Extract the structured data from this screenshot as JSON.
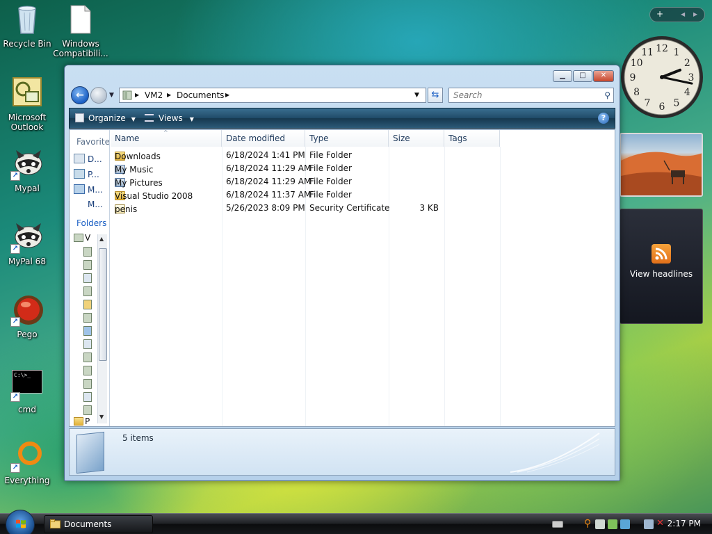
{
  "desktop": {
    "icons": [
      {
        "label": "Recycle Bin"
      },
      {
        "label": "Windows Compatibili..."
      },
      {
        "label": "Microsoft Outlook"
      },
      {
        "label": "Mypal"
      },
      {
        "label": "MyPal 68"
      },
      {
        "label": "Pego"
      },
      {
        "label": "cmd"
      },
      {
        "label": "Everything"
      }
    ],
    "cmd_prompt_text": "C:\\>_"
  },
  "gadgets": {
    "bar_plus": "+",
    "bar_prev": "◀",
    "bar_next": "▶",
    "clock_numbers": [
      "12",
      "1",
      "2",
      "3",
      "4",
      "5",
      "6",
      "7",
      "8",
      "9",
      "10",
      "11"
    ],
    "clock_hour": 2,
    "clock_minute": 17,
    "feed_label": "View headlines"
  },
  "window": {
    "address_segments": [
      "VM2",
      "Documents"
    ],
    "search_placeholder": "Search",
    "organize_label": "Organize",
    "views_label": "Views",
    "help_label": "?",
    "nav_pane": {
      "favorites_header": "Favorite l",
      "favorites": [
        "D...",
        "P...",
        "M...",
        "M..."
      ],
      "folders_header": "Folders",
      "tree_top": "V",
      "tree_bottom": "P"
    },
    "columns": [
      "Name",
      "Date modified",
      "Type",
      "Size",
      "Tags"
    ],
    "files": [
      {
        "name": "Downloads",
        "date": "6/18/2024 1:41 PM",
        "type": "File Folder",
        "size": "",
        "icon": "folder-icon"
      },
      {
        "name": "My Music",
        "date": "6/18/2024 11:29 AM",
        "type": "File Folder",
        "size": "",
        "icon": "music-folder-icon"
      },
      {
        "name": "My Pictures",
        "date": "6/18/2024 11:29 AM",
        "type": "File Folder",
        "size": "",
        "icon": "pictures-folder-icon"
      },
      {
        "name": "Visual Studio 2008",
        "date": "6/18/2024 11:37 AM",
        "type": "File Folder",
        "size": "",
        "icon": "folder-icon"
      },
      {
        "name": "penis",
        "date": "5/26/2023 8:09 PM",
        "type": "Security Certificate",
        "size": "3 KB",
        "icon": "certificate-icon"
      }
    ],
    "status": "5 items"
  },
  "taskbar": {
    "active_task": "Documents",
    "time": "2:17 PM"
  }
}
